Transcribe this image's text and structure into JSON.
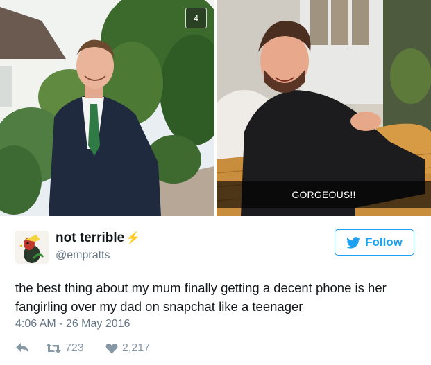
{
  "media": {
    "image_count": "4",
    "caption": "GORGEOUS!!"
  },
  "author": {
    "display_name": "not terrible",
    "name_emoji": "⚡",
    "handle": "@empratts",
    "avatar_icon": "rooster-avatar"
  },
  "follow": {
    "label": "Follow",
    "icon": "twitter-bird-icon",
    "color": "#1da1f2"
  },
  "tweet": {
    "text": "the best thing about my mum finally getting a decent phone is her fangirling over my dad on snapchat like a teenager",
    "timestamp": "4:06 AM - 26 May 2016"
  },
  "actions": {
    "retweets": "723",
    "likes": "2,217"
  }
}
